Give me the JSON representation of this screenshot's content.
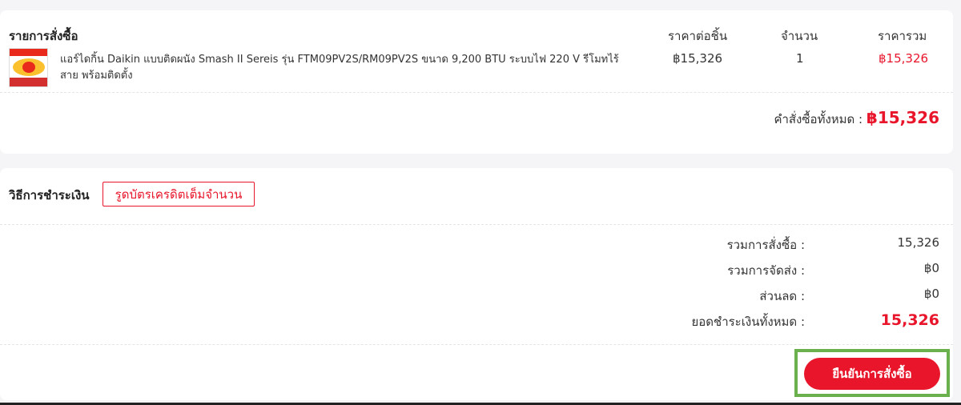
{
  "order": {
    "title": "รายการสั่งซื้อ",
    "col_unit": "ราคาต่อชิ้น",
    "col_qty": "จำนวน",
    "col_total": "ราคารวม",
    "item": {
      "name": "แอร์ไดกิ้น Daikin แบบติดผนัง Smash II Sereis รุ่น FTM09PV2S/RM09PV2S ขนาด 9,200 BTU ระบบไฟ 220 V รีโมทไร้สาย พร้อมติดตั้ง",
      "unit_price": "฿15,326",
      "qty": "1",
      "total": "฿15,326"
    },
    "grand_label": "คำสั่งซื้อทั้งหมด :",
    "grand_amount": "฿15,326"
  },
  "payment": {
    "label": "วิธีการชำระเงิน",
    "method": "รูดบัตรเครดิตเต็มจำนวน"
  },
  "summary": {
    "subtotal_label": "รวมการสั่งซื้อ :",
    "subtotal_value": "15,326",
    "shipping_label": "รวมการจัดส่ง :",
    "shipping_value": "฿0",
    "discount_label": "ส่วนลด :",
    "discount_value": "฿0",
    "total_label": "ยอดชำระเงินทั้งหมด :",
    "total_value": "15,326"
  },
  "confirm_label": "ยืนยันการสั่งซื้อ",
  "colors": {
    "accent": "#e8152b",
    "highlight": "#6ab04c"
  }
}
